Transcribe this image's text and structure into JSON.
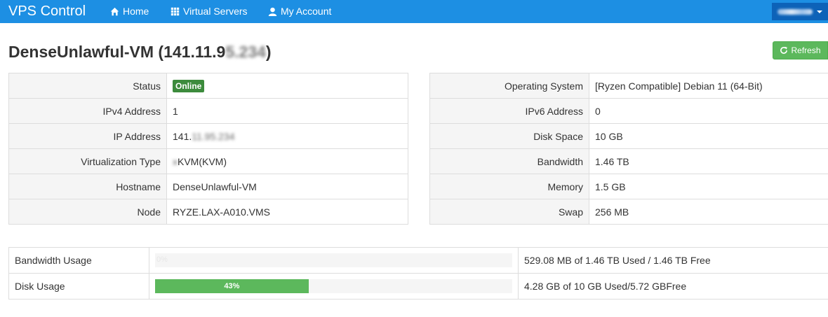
{
  "navbar": {
    "brand": "VPS Control",
    "links": [
      {
        "label": "Home",
        "icon": "home-icon"
      },
      {
        "label": "Virtual Servers",
        "icon": "grid-icon"
      },
      {
        "label": "My Account",
        "icon": "user-icon"
      }
    ]
  },
  "page": {
    "title_prefix": "DenseUnlawful-VM (141.11.9",
    "title_blurred": "5.234",
    "title_suffix": ")",
    "refresh_label": "Refresh"
  },
  "left_info": [
    {
      "label": "Status",
      "value": "Online",
      "type": "badge"
    },
    {
      "label": "IPv4 Address",
      "value": "1"
    },
    {
      "label": "IP Address",
      "value_prefix": "141.",
      "value_blurred": "11.95.234"
    },
    {
      "label": "Virtualization Type",
      "value_blurred": "x",
      "value": "KVM(KVM)"
    },
    {
      "label": "Hostname",
      "value": "DenseUnlawful-VM"
    },
    {
      "label": "Node",
      "value": "RYZE.LAX-A010.VMS"
    }
  ],
  "right_info": [
    {
      "label": "Operating System",
      "value": "[Ryzen Compatible] Debian 11 (64-Bit)"
    },
    {
      "label": "IPv6 Address",
      "value": "0"
    },
    {
      "label": "Disk Space",
      "value": "10 GB"
    },
    {
      "label": "Bandwidth",
      "value": "1.46 TB"
    },
    {
      "label": "Memory",
      "value": "1.5 GB"
    },
    {
      "label": "Swap",
      "value": "256 MB"
    }
  ],
  "usage": [
    {
      "label": "Bandwidth Usage",
      "percent": 0,
      "percent_label": "0%",
      "summary": "529.08 MB of 1.46 TB Used / 1.46 TB Free"
    },
    {
      "label": "Disk Usage",
      "percent": 43,
      "percent_label": "43%",
      "summary": "4.28 GB of 10 GB Used/5.72 GBFree"
    }
  ],
  "colors": {
    "navbar": "#1d8fe3",
    "success": "#5cb85c",
    "online_badge": "#3c8b3c"
  }
}
